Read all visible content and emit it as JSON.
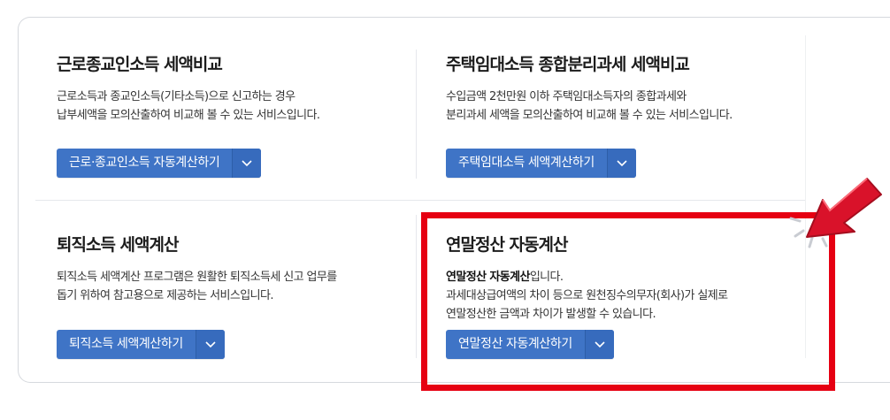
{
  "cards": [
    {
      "title": "근로종교인소득 세액비교",
      "desc_line1": "근로소득과 종교인소득(기타소득)으로 신고하는 경우",
      "desc_line2": "납부세액을 모의산출하여 비교해 볼 수 있는 서비스입니다.",
      "button_label": "근로·종교인소득 자동계산하기"
    },
    {
      "title": "주택임대소득 종합분리과세 세액비교",
      "desc_line1": "수입금액 2천만원 이하 주택임대소득자의 종합과세와",
      "desc_line2": "분리과세 세액을 모의산출하여 비교해 볼 수 있는 서비스입니다.",
      "button_label": "주택임대소득 세액계산하기"
    },
    {
      "title": "퇴직소득 세액계산",
      "desc_line1": "퇴직소득 세액계산 프로그램은 원활한 퇴직소득세 신고 업무를",
      "desc_line2": "돕기 위하여 참고용으로 제공하는 서비스입니다.",
      "button_label": "퇴직소득 세액계산하기"
    },
    {
      "title": "연말정산 자동계산",
      "desc_bold": "연말정산 자동계산",
      "desc_bold_suffix": "입니다.",
      "desc_line2": "과세대상급여액의 차이 등으로 원천징수의무자(회사)가 실제로",
      "desc_line3": "연말정산한 금액과 차이가 발생할 수 있습니다.",
      "button_label": "연말정산 자동계산하기"
    }
  ],
  "icons": {
    "dropdown": "chevron-down-icon",
    "annotation": "pointer-arrow-icon"
  },
  "colors": {
    "button_bg": "#3f74c6",
    "highlight_border": "#e60012",
    "arrow": "#d9122a"
  }
}
